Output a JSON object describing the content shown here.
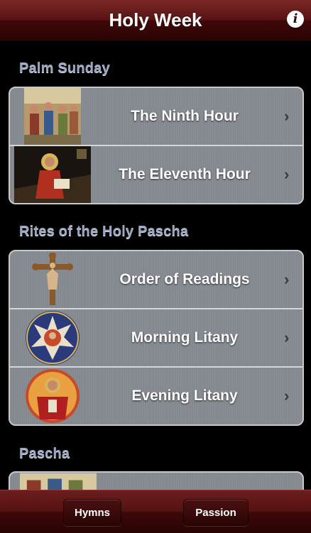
{
  "navbar": {
    "title": "Holy Week",
    "info_icon": "info-icon"
  },
  "sections": [
    {
      "header": "Palm Sunday",
      "items": [
        {
          "label": "The Ninth Hour",
          "icon": "icon-crowd-painting"
        },
        {
          "label": "The Eleventh Hour",
          "icon": "icon-saint-writing"
        }
      ]
    },
    {
      "header": "Rites of the Holy Pascha",
      "items": [
        {
          "label": "Order of Readings",
          "icon": "crucifix-icon"
        },
        {
          "label": "Morning Litany",
          "icon": "star-icon"
        },
        {
          "label": "Evening Litany",
          "icon": "christ-icon"
        }
      ]
    },
    {
      "header": "Pascha",
      "items": []
    }
  ],
  "tabbar": {
    "hymns_label": "Hymns",
    "passion_label": "Passion"
  },
  "colors": {
    "navbar": "#5a1414",
    "section_header": "#9aa6bf",
    "row_bg": "#888c93"
  }
}
